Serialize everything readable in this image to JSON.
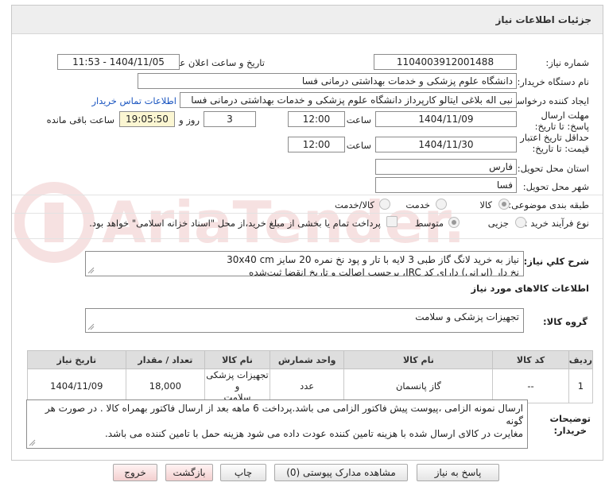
{
  "header": {
    "title": "جزئیات اطلاعات نیاز"
  },
  "form": {
    "need_number_label": "شماره نیاز:",
    "need_number": "1104003912001488",
    "announce_label": "تاریخ و ساعت اعلان عمومی:",
    "announce_value": "1404/11/05 - 11:53",
    "buyer_org_label": "نام دستگاه خریدار:",
    "buyer_org": "دانشگاه علوم پزشکی و خدمات بهداشتی درمانی فسا",
    "requester_label": "ایجاد کننده درخواست:",
    "requester": "نبی اله بلاغی ایتالو کارپرداز دانشگاه علوم پزشکی و خدمات بهداشتی درمانی فسا",
    "contact_link": "اطلاعات تماس خریدار",
    "deadline_label": "مهلت ارسال پاسخ: تا تاریخ:",
    "deadline_date": "1404/11/09",
    "time_word": "ساعت",
    "deadline_time": "12:00",
    "days_value": "3",
    "days_word": "روز و",
    "remaining_time": "19:05:50",
    "remaining_word": "ساعت باقی مانده",
    "validity_label": "حداقل تاریخ اعتبار قیمت: تا تاریخ:",
    "validity_date": "1404/11/30",
    "validity_time": "12:00",
    "province_label": "استان محل تحویل:",
    "province": "فارس",
    "city_label": "شهر محل تحویل:",
    "city": "فسا",
    "category_label": "طبقه بندی موضوعی:",
    "category_options": [
      "کالا",
      "خدمت",
      "کالا/خدمت"
    ],
    "process_label": "نوع فرآیند خرید :",
    "process_options": [
      "جزیی",
      "متوسط"
    ],
    "payment_note": "پرداخت تمام یا بخشی از مبلغ خرید،از محل \"اسناد خزانه اسلامی\" خواهد بود."
  },
  "description": {
    "label": "شرح کلي نياز:",
    "line1": "نیاز به خرید لانگ گاز طبی 3 لایه با تار و پود نخ نمره 20 سایز 30x40 cm",
    "line2": "نخ دار (ایرانی) دارای کد IRC، برچسب اصالت و تاریخ انقضا ثبت‌شده"
  },
  "goods": {
    "section_title": "اطلاعات کالاهای مورد نیاز",
    "group_label": "گروه کالا:",
    "group_value": "تجهیزات پزشکی و سلامت"
  },
  "table": {
    "headers": [
      "ردیف",
      "کد کالا",
      "نام کالا",
      "واحد شمارش",
      "تعداد / مقدار",
      "تاریخ نیاز"
    ],
    "rows": [
      {
        "row": "1",
        "code": "--",
        "name": "گاز پانسمان",
        "unit": "عدد",
        "qty": "18,000",
        "date": "1404/11/09"
      }
    ],
    "extra_header": "نام کالا",
    "extra_cell_line1": "تجهیزات پزشکی و",
    "extra_cell_line2": "سلامت"
  },
  "buyer_notes": {
    "label_line1": "توضیحات",
    "label_line2": "خریدار:",
    "line1": "ارسال نمونه الزامی ،پیوست پیش فاکتور الزامی می باشد.پرداخت 6 ماهه بعد از ارسال فاکتور بهمراه کالا . در صورت هر گونه",
    "line2": "مغایرت در کالای ارسال شده با هزینه تامین کننده  عودت داده می شود  هزینه حمل با تامین  کننده می باشد."
  },
  "buttons": {
    "reply": "پاسخ به نیاز",
    "attachments": "مشاهده مدارک پیوستی (0)",
    "print": "چاپ",
    "back": "بازگشت",
    "exit": "خروج"
  },
  "colors": {
    "link": "#1a55c0",
    "highlight": "#fbf6d2",
    "header": "#eeeeee"
  }
}
